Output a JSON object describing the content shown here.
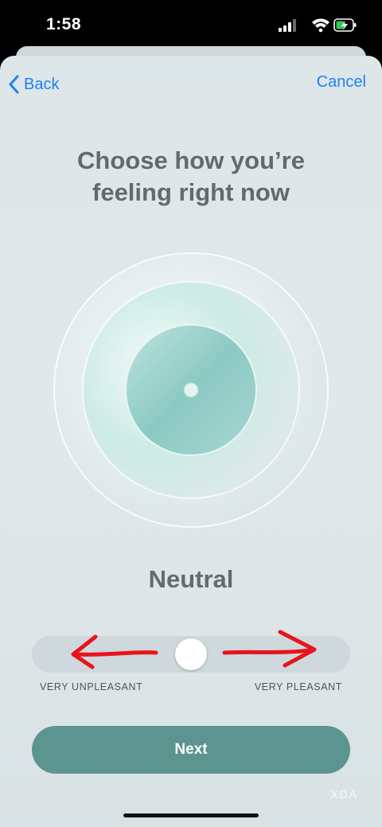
{
  "status": {
    "time": "1:58"
  },
  "nav": {
    "back_label": "Back",
    "cancel_label": "Cancel"
  },
  "title": "Choose how you’re\nfeeling right now",
  "mood": {
    "label": "Neutral",
    "slider_value": 0.5
  },
  "slider": {
    "min_label": "VERY UNPLEASANT",
    "max_label": "VERY PLEASANT"
  },
  "next_label": "Next",
  "watermark": "XDA",
  "colors": {
    "accent": "#1d82f0",
    "button": "#5c9590",
    "annotation": "#e8141c"
  }
}
